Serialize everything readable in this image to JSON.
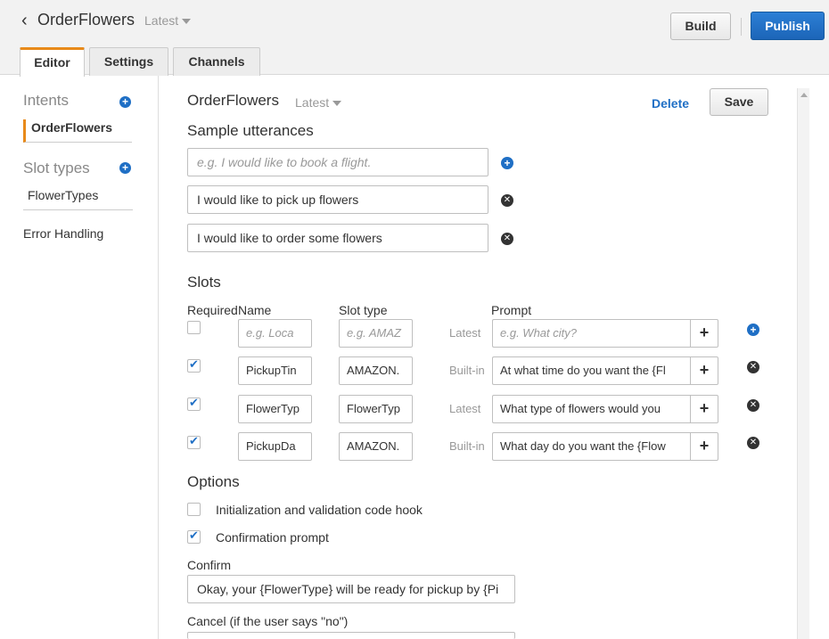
{
  "header": {
    "bot_name": "OrderFlowers",
    "version": "Latest",
    "build_label": "Build",
    "publish_label": "Publish",
    "tabs": [
      {
        "label": "Editor"
      },
      {
        "label": "Settings"
      },
      {
        "label": "Channels"
      }
    ]
  },
  "sidebar": {
    "intents_heading": "Intents",
    "intents": [
      {
        "label": "OrderFlowers"
      }
    ],
    "slot_types_heading": "Slot types",
    "slot_types": [
      {
        "label": "FlowerTypes"
      }
    ],
    "error_handling_label": "Error Handling"
  },
  "main": {
    "intent_name": "OrderFlowers",
    "version": "Latest",
    "delete_label": "Delete",
    "save_label": "Save",
    "utterances_title": "Sample utterances",
    "utterance_placeholder": "e.g. I would like to book a flight.",
    "utterances": [
      "I would like to pick up flowers",
      "I would like to order some flowers"
    ],
    "slots_title": "Slots",
    "slot_columns": {
      "required": "Required",
      "name": "Name",
      "slot_type": "Slot type",
      "prompt": "Prompt"
    },
    "new_slot": {
      "name_placeholder": "e.g. Loca",
      "type_placeholder": "e.g. AMAZ",
      "version": "Latest",
      "prompt_placeholder": "e.g. What city?"
    },
    "slots": [
      {
        "required": true,
        "name": "PickupTin",
        "type": "AMAZON.",
        "version": "Built-in",
        "prompt": "At what time do you want the {Fl"
      },
      {
        "required": true,
        "name": "FlowerTyp",
        "type": "FlowerTyp",
        "version": "Latest",
        "prompt": "What type of flowers would you"
      },
      {
        "required": true,
        "name": "PickupDa",
        "type": "AMAZON.",
        "version": "Built-in",
        "prompt": "What day do you want the {Flow"
      }
    ],
    "options_title": "Options",
    "options": [
      {
        "label": "Initialization and validation code hook",
        "checked": false
      },
      {
        "label": "Confirmation prompt",
        "checked": true
      }
    ],
    "confirm_label": "Confirm",
    "confirm_value": "Okay, your {FlowerType} will be ready for pickup by {Pi",
    "cancel_label": "Cancel (if the user says \"no\")"
  },
  "colors": {
    "accent": "#e88a1a",
    "primary": "#1f6fc5"
  }
}
